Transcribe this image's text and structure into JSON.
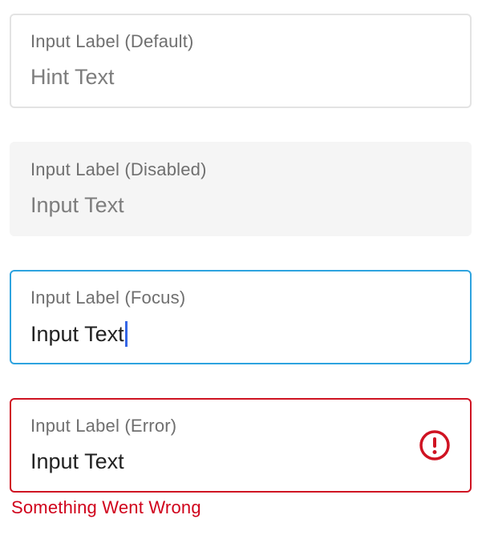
{
  "fields": {
    "default": {
      "label": "Input Label (Default)",
      "placeholder": "Hint Text"
    },
    "disabled": {
      "label": "Input Label (Disabled)",
      "value": "Input Text"
    },
    "focus": {
      "label": "Input Label (Focus)",
      "value": "Input Text"
    },
    "error": {
      "label": "Input Label (Error)",
      "value": "Input Text",
      "icon": "exclamation-circle-icon",
      "message": "Something Went Wrong"
    }
  },
  "colors": {
    "default_border": "#e3e3e3",
    "disabled_background": "#f5f5f5",
    "focus_border": "#2ea3df",
    "caret": "#3566e6",
    "error": "#cf1322",
    "label_text": "#6f6f6f",
    "input_text": "#222222"
  }
}
